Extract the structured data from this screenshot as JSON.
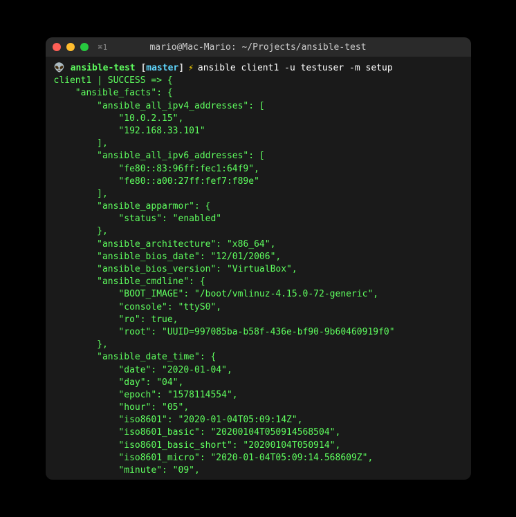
{
  "titlebar": {
    "shortcut": "⌘1",
    "title": "mario@Mac-Mario: ~/Projects/ansible-test"
  },
  "prompt": {
    "icon": "👽",
    "dir": "ansible-test",
    "branch": "master",
    "bolt": "⚡",
    "command": "ansible client1 -u testuser -m setup"
  },
  "result_header": "client1 | SUCCESS => {",
  "lines": [
    "    \"ansible_facts\": {",
    "        \"ansible_all_ipv4_addresses\": [",
    "            \"10.0.2.15\",",
    "            \"192.168.33.101\"",
    "        ],",
    "        \"ansible_all_ipv6_addresses\": [",
    "            \"fe80::83:96ff:fec1:64f9\",",
    "            \"fe80::a00:27ff:fef7:f89e\"",
    "        ],",
    "        \"ansible_apparmor\": {",
    "            \"status\": \"enabled\"",
    "        },",
    "        \"ansible_architecture\": \"x86_64\",",
    "        \"ansible_bios_date\": \"12/01/2006\",",
    "        \"ansible_bios_version\": \"VirtualBox\",",
    "        \"ansible_cmdline\": {",
    "            \"BOOT_IMAGE\": \"/boot/vmlinuz-4.15.0-72-generic\",",
    "            \"console\": \"ttyS0\",",
    "            \"ro\": true,",
    "            \"root\": \"UUID=997085ba-b58f-436e-bf90-9b60460919f0\"",
    "        },",
    "        \"ansible_date_time\": {",
    "            \"date\": \"2020-01-04\",",
    "            \"day\": \"04\",",
    "            \"epoch\": \"1578114554\",",
    "            \"hour\": \"05\",",
    "            \"iso8601\": \"2020-01-04T05:09:14Z\",",
    "            \"iso8601_basic\": \"20200104T050914568504\",",
    "            \"iso8601_basic_short\": \"20200104T050914\",",
    "            \"iso8601_micro\": \"2020-01-04T05:09:14.568609Z\",",
    "            \"minute\": \"09\","
  ]
}
